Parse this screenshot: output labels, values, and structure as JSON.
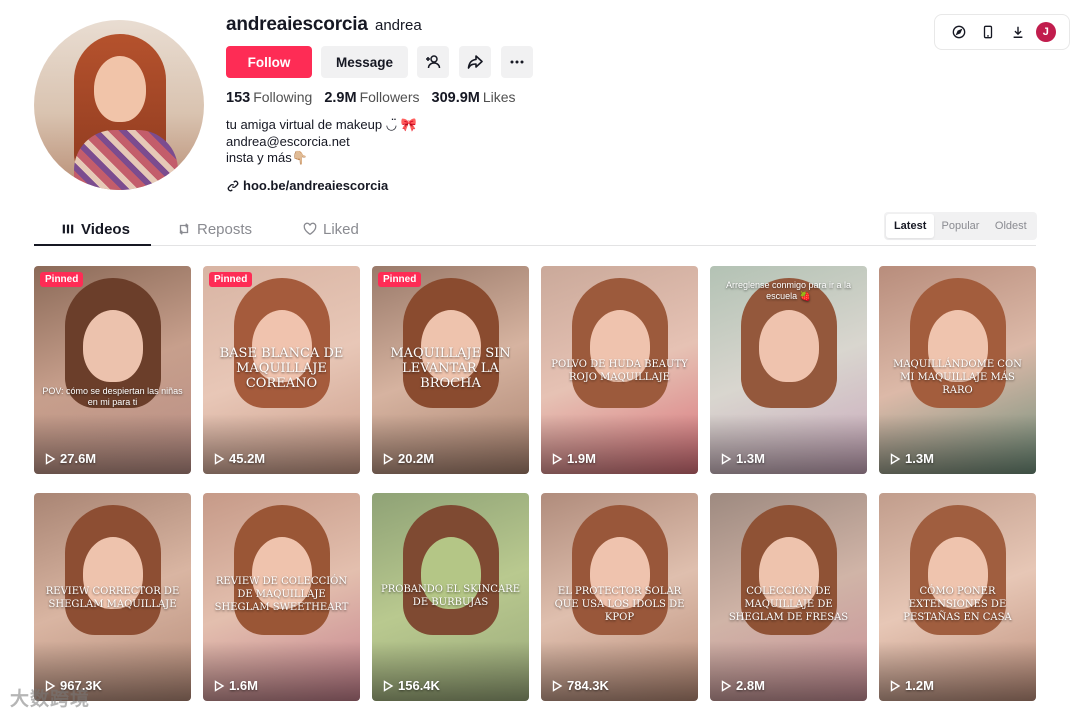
{
  "profile": {
    "username": "andreaiescorcia",
    "nickname": "andrea",
    "follow_label": "Follow",
    "message_label": "Message",
    "stats": {
      "following_count": "153",
      "following_label": "Following",
      "followers_count": "2.9M",
      "followers_label": "Followers",
      "likes_count": "309.9M",
      "likes_label": "Likes"
    },
    "bio_lines": [
      "tu amiga virtual de makeup ◡̈ 🎀",
      "andrea@escorcia.net",
      "insta y más👇🏼"
    ],
    "link": "hoo.be/andreaiescorcia"
  },
  "topbar": {
    "user_initial": "J"
  },
  "tabs": [
    {
      "label": "Videos",
      "icon": "grid-icon",
      "active": true
    },
    {
      "label": "Reposts",
      "icon": "repost-icon",
      "active": false
    },
    {
      "label": "Liked",
      "icon": "heart-lock-icon",
      "active": false
    }
  ],
  "sort": [
    "Latest",
    "Popular",
    "Oldest"
  ],
  "videos": [
    {
      "pinned": "Pinned",
      "caption": "POV: cómo se despiertan las niñas en mi para ti",
      "views": "27.6M"
    },
    {
      "pinned": "Pinned",
      "caption": "BASE BLANCA DE MAQUILLAJE COREANO",
      "views": "45.2M"
    },
    {
      "pinned": "Pinned",
      "caption": "MAQUILLAJE SIN LEVANTAR LA BROCHA",
      "views": "20.2M"
    },
    {
      "pinned": "",
      "caption": "POLVO DE HUDA BEAUTY ROJO MAQUILLAJE",
      "views": "1.9M"
    },
    {
      "pinned": "",
      "caption": "Arreglense conmigo para ir a la escuela 🍓",
      "views": "1.3M"
    },
    {
      "pinned": "",
      "caption": "MAQUILLÁNDOME CON MI MAQUILLAJE MÁS RARO",
      "views": "1.3M"
    },
    {
      "pinned": "",
      "caption": "REVIEW CORRECTOR DE SHEGLAM MAQUILLAJE",
      "views": "967.3K"
    },
    {
      "pinned": "",
      "caption": "REVIEW DE COLECCIÓN DE MAQUILLAJE SHEGLAM SWEETHEART",
      "views": "1.6M"
    },
    {
      "pinned": "",
      "caption": "PROBANDO EL SKINCARE DE BURBUJAS",
      "views": "156.4K"
    },
    {
      "pinned": "",
      "caption": "EL PROTECTOR SOLAR QUE USA LOS IDOLS DE KPOP",
      "views": "784.3K"
    },
    {
      "pinned": "",
      "caption": "COLECCIÓN DE MAQUILLAJE DE SHEGLAM DE FRESAS",
      "views": "2.8M"
    },
    {
      "pinned": "",
      "caption": "CÓMO PONER EXTENSIONES DE PESTAÑAS EN CASA",
      "views": "1.2M"
    }
  ],
  "watermark": "大数跨境",
  "colors": {
    "accent": "#fe2c55",
    "text": "#161823",
    "muted": "#8a8b91"
  }
}
